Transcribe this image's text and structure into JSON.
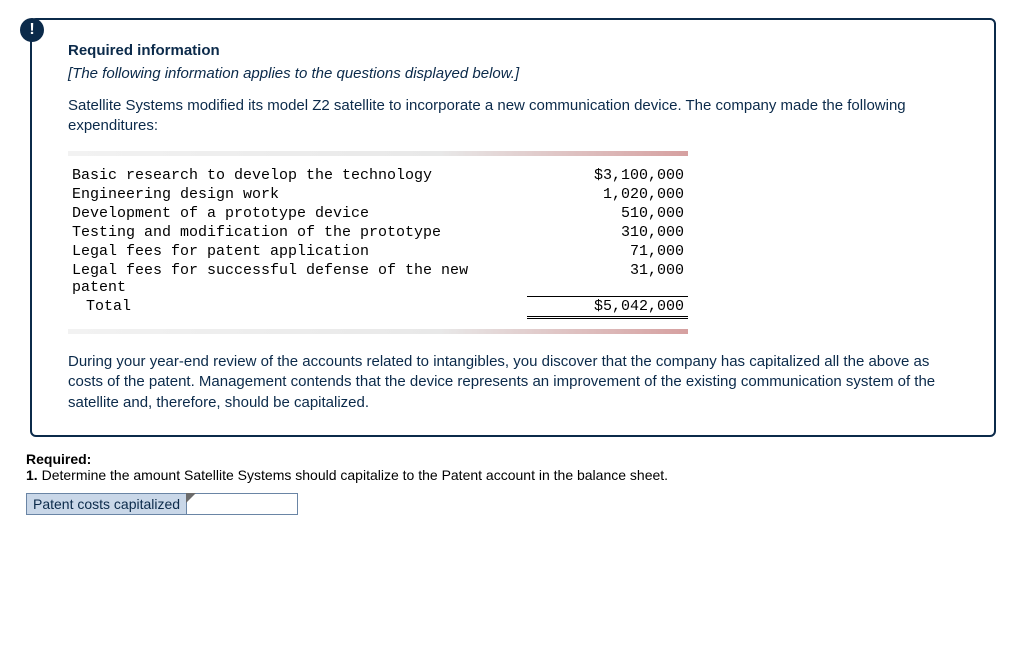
{
  "badge_char": "!",
  "heading": "Required information",
  "subnote": "[The following information applies to the questions displayed below.]",
  "intro": "Satellite Systems modified its model Z2 satellite to incorporate a new communication device. The company made the following expenditures:",
  "table": {
    "rows": [
      {
        "label": "Basic research to develop the technology",
        "value": "$3,100,000"
      },
      {
        "label": "Engineering design work",
        "value": "1,020,000"
      },
      {
        "label": "Development of a prototype device",
        "value": "510,000"
      },
      {
        "label": "Testing and modification of the prototype",
        "value": "310,000"
      },
      {
        "label": "Legal fees for patent application",
        "value": "71,000"
      },
      {
        "label": "Legal fees for successful defense of the new patent",
        "value": "31,000"
      }
    ],
    "total_label": "Total",
    "total_value": "$5,042,000"
  },
  "closing": "During your year-end review of the accounts related to intangibles, you discover that the company has capitalized all the above as costs of the patent. Management contends that the device represents an improvement of the existing communication system of the satellite and, therefore, should be capitalized.",
  "required_heading": "Required:",
  "required_item": "1. Determine the amount Satellite Systems should capitalize to the Patent account in the balance sheet.",
  "answer": {
    "label": "Patent costs capitalized",
    "value": ""
  }
}
